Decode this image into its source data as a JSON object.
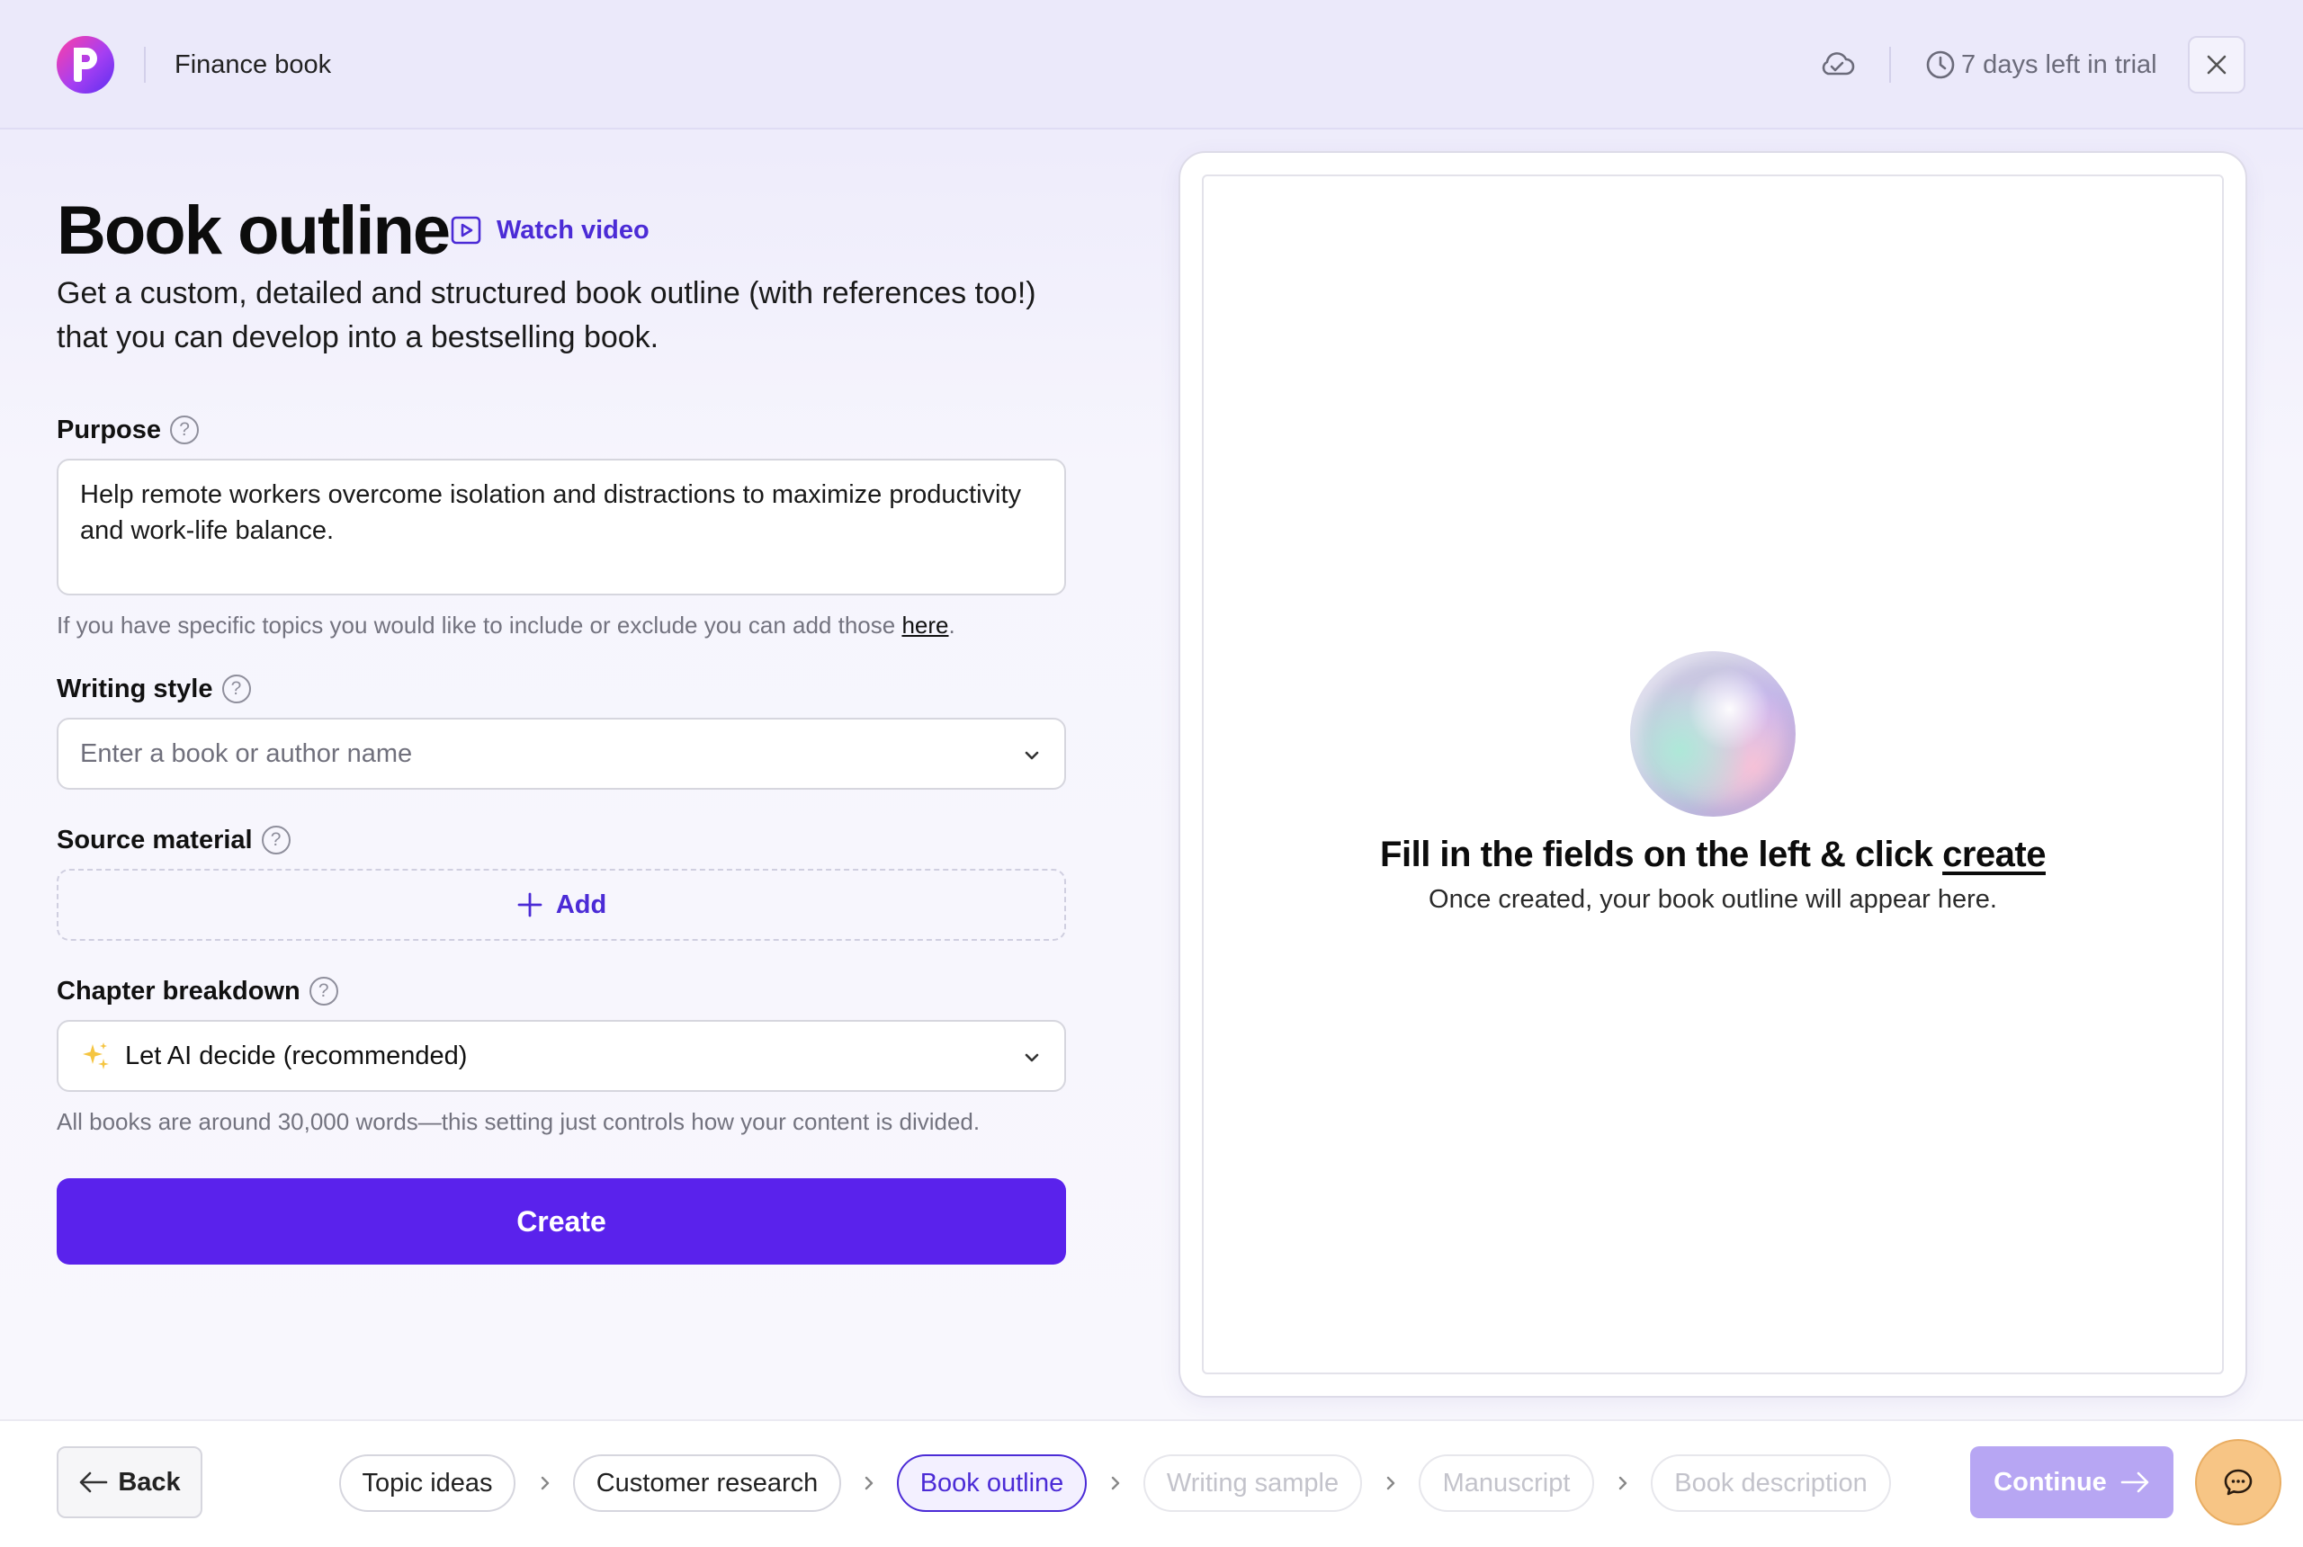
{
  "header": {
    "project_name": "Finance book",
    "trial_text": "7 days left in trial",
    "icons": {
      "sync": "cloud-check-icon",
      "trial": "clock-icon",
      "close": "close-icon"
    }
  },
  "page": {
    "title": "Book outline",
    "watch_video_label": "Watch video",
    "subtitle": "Get a custom, detailed and structured book outline (with references too!) that you can develop into a bestselling book."
  },
  "form": {
    "purpose": {
      "label": "Purpose",
      "value": "Help remote workers overcome isolation and distractions to maximize productivity and work-life balance.",
      "helper_prefix": "If you have specific topics you would like to include or exclude you can add those ",
      "helper_link": "here",
      "helper_suffix": "."
    },
    "writing_style": {
      "label": "Writing style",
      "placeholder": "Enter a book or author name"
    },
    "source_material": {
      "label": "Source material",
      "add_label": "Add"
    },
    "chapter_breakdown": {
      "label": "Chapter breakdown",
      "value": "Let AI decide (recommended)",
      "helper": "All books are around 30,000 words—this setting just controls how your content is divided."
    },
    "create_label": "Create"
  },
  "preview": {
    "title_prefix": "Fill in the fields on the left & click ",
    "title_link": "create",
    "subtitle": "Once created, your book outline will appear here."
  },
  "footer": {
    "back_label": "Back",
    "steps": [
      {
        "label": "Topic ideas",
        "state": "done"
      },
      {
        "label": "Customer research",
        "state": "done"
      },
      {
        "label": "Book outline",
        "state": "active"
      },
      {
        "label": "Writing sample",
        "state": "disabled"
      },
      {
        "label": "Manuscript",
        "state": "disabled"
      },
      {
        "label": "Book description",
        "state": "disabled"
      }
    ],
    "continue_label": "Continue"
  },
  "colors": {
    "accent": "#5a22ec",
    "accent_text": "#4b2bd6",
    "continue_disabled": "#b7a6f3",
    "chat_button": "#f7c585"
  }
}
